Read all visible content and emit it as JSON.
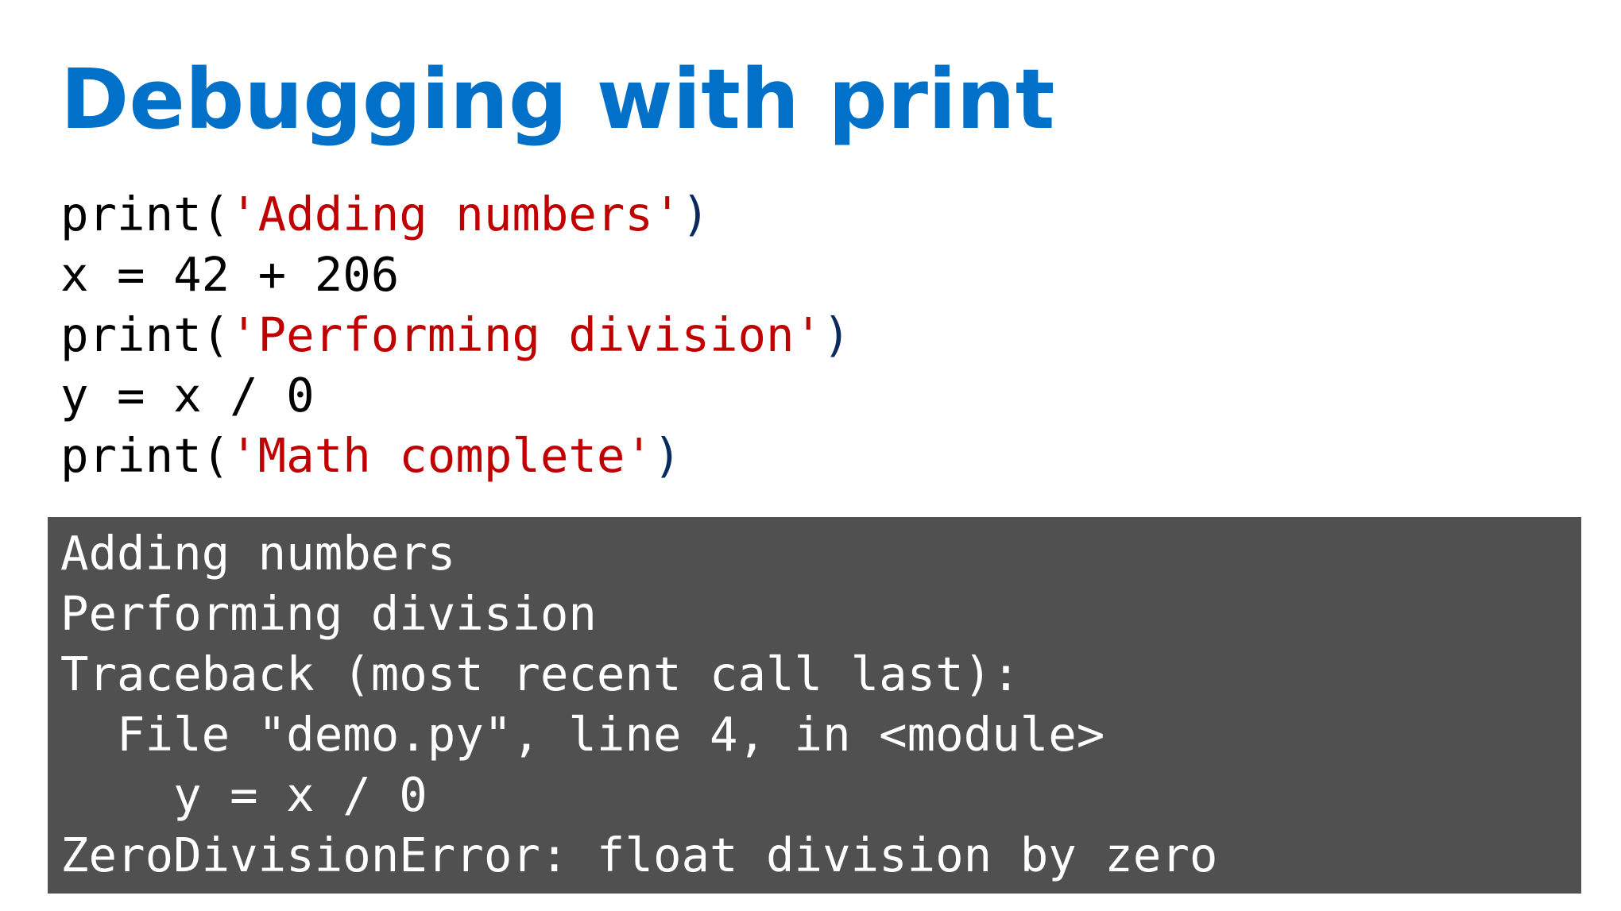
{
  "slide": {
    "title": "Debugging with print",
    "colors": {
      "title": "#0070c8",
      "string": "#c00000",
      "paren_close": "#0b2a5e",
      "code_text": "#000000",
      "output_bg": "#505050",
      "output_text": "#ffffff"
    },
    "code": {
      "line1": {
        "fn": "print",
        "open": "(",
        "str": "'Adding numbers'",
        "close": ")"
      },
      "line2": {
        "text": "x = 42 + 206"
      },
      "line3": {
        "fn": "print",
        "open": "(",
        "str": "'Performing division'",
        "close": ")"
      },
      "line4": {
        "text": "y = x / 0"
      },
      "line5": {
        "fn": "print",
        "open": "(",
        "str": "'Math complete'",
        "close": ")"
      }
    },
    "output": [
      "Adding numbers",
      "Performing division",
      "Traceback (most recent call last):",
      "  File \"demo.py\", line 4, in <module>",
      "    y = x / 0",
      "ZeroDivisionError: float division by zero"
    ]
  }
}
